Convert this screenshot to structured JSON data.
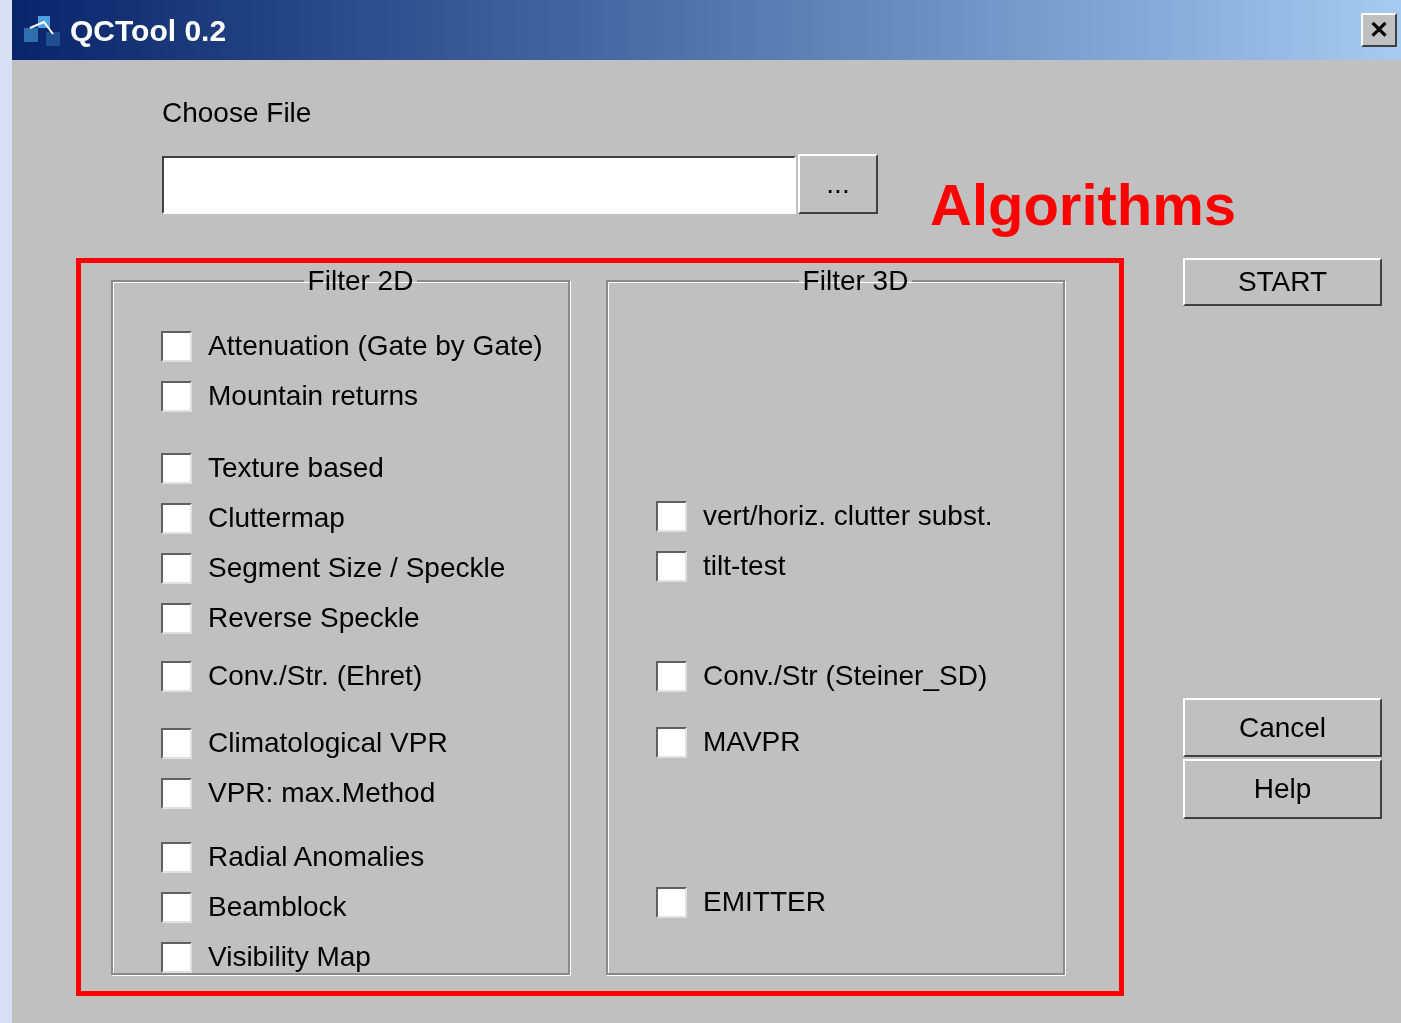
{
  "window": {
    "title": "QCTool 0.2",
    "close": "✕"
  },
  "file": {
    "label": "Choose File",
    "browse": "..."
  },
  "annotation": {
    "label": "Algorithms"
  },
  "panels": [
    {
      "title": "Filter 2D",
      "groups": [
        [
          {
            "label": "Attenuation (Gate by Gate)",
            "checked": false
          },
          {
            "label": "Mountain returns",
            "checked": false
          }
        ],
        [
          {
            "label": "Texture based",
            "checked": false
          },
          {
            "label": "Cluttermap",
            "checked": false
          },
          {
            "label": "Segment Size / Speckle",
            "checked": false
          },
          {
            "label": "Reverse Speckle",
            "checked": false
          }
        ],
        [
          {
            "label": "Conv./Str. (Ehret)",
            "checked": false
          }
        ],
        [
          {
            "label": "Climatological VPR",
            "checked": false
          },
          {
            "label": "VPR: max.Method",
            "checked": false
          }
        ],
        [
          {
            "label": "Radial Anomalies",
            "checked": false
          },
          {
            "label": "Beamblock",
            "checked": false
          },
          {
            "label": "Visibility Map",
            "checked": false
          }
        ]
      ]
    },
    {
      "title": "Filter 3D",
      "groups": [
        [
          {
            "label": "vert/horiz. clutter subst.",
            "checked": false
          },
          {
            "label": "tilt-test",
            "checked": false
          }
        ],
        [
          {
            "label": "Conv./Str (Steiner_SD)",
            "checked": false
          }
        ],
        [
          {
            "label": "MAVPR",
            "checked": false
          }
        ],
        [
          {
            "label": "EMITTER",
            "checked": false
          }
        ]
      ]
    }
  ],
  "buttons": {
    "start": "START",
    "cancel": "Cancel",
    "help": "Help"
  }
}
